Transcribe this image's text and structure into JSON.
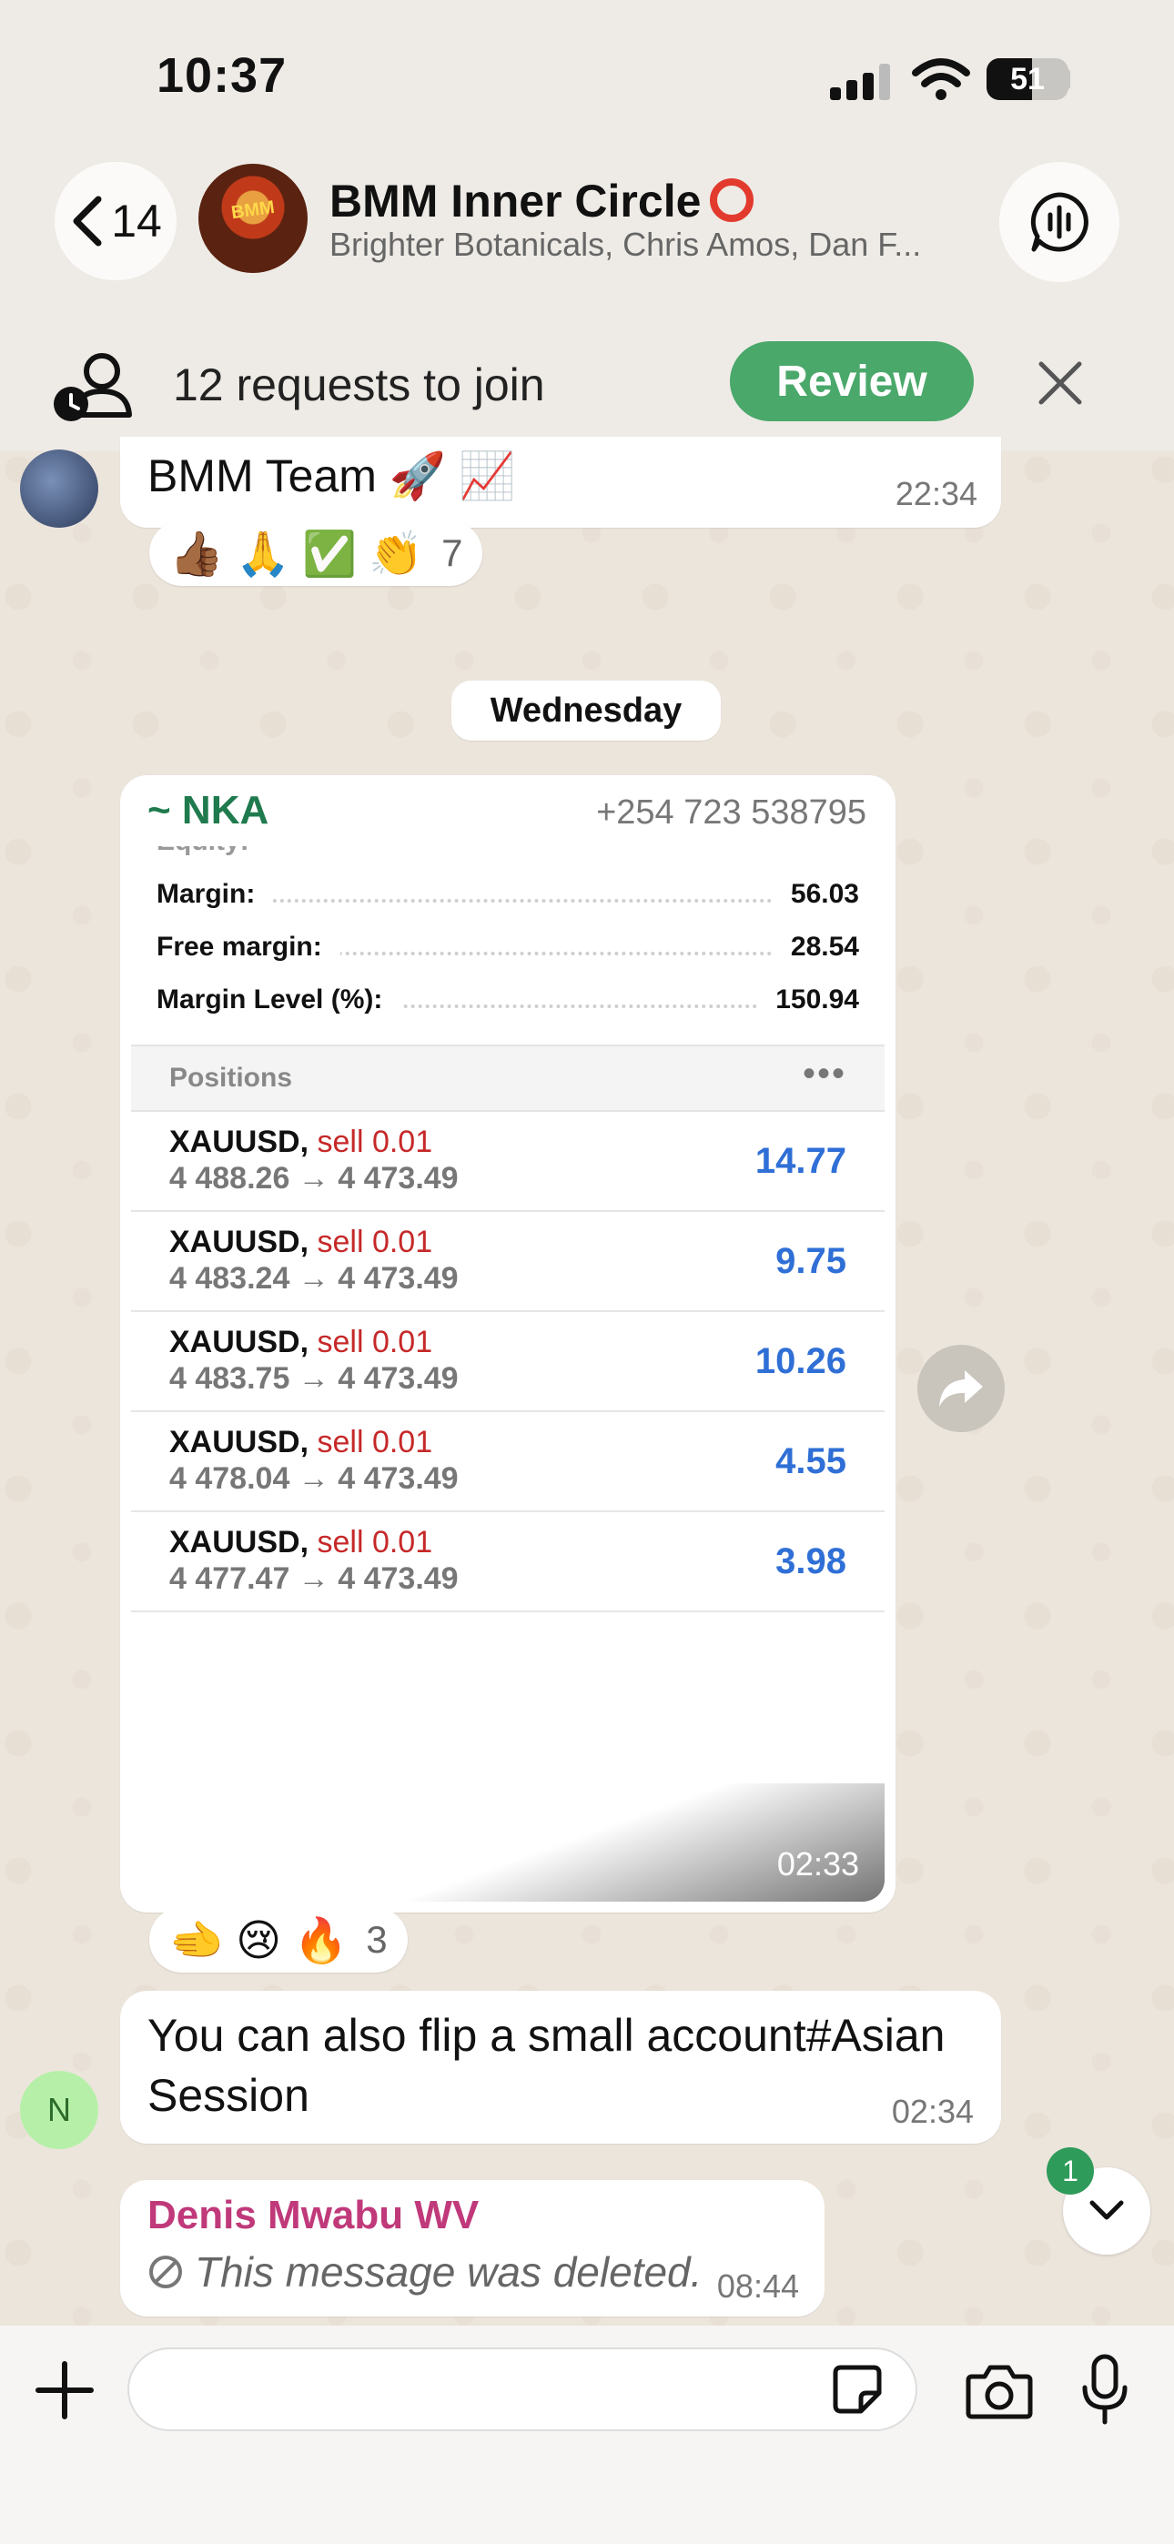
{
  "status": {
    "time": "10:37",
    "battery": "51"
  },
  "header": {
    "back_count": "14",
    "avatar_text": "BMM",
    "title": "BMM Inner Circle",
    "subtitle": "Brighter Botanicals, Chris Amos, Dan F..."
  },
  "join": {
    "text": "12 requests to join",
    "review_label": "Review"
  },
  "messages": {
    "m1": {
      "text": "BMM Team 🚀 📈",
      "time": "22:34",
      "reactions": "👍🏾 🙏 ✅ 👏",
      "reaction_count": "7"
    },
    "day": "Wednesday",
    "image_msg": {
      "sender": "~ NKA",
      "phone": "+254 723 538795",
      "time": "02:33",
      "reactions": "🫲 😢 🔥",
      "reaction_count": "3",
      "account": [
        {
          "label": "Margin:",
          "value": "56.03"
        },
        {
          "label": "Free margin:",
          "value": "28.54"
        },
        {
          "label": "Margin Level (%):",
          "value": "150.94"
        }
      ],
      "positions_title": "Positions",
      "positions": [
        {
          "symbol": "XAUUSD,",
          "side": "sell 0.01",
          "prices": "4 488.26 → 4 473.49",
          "pl": "14.77"
        },
        {
          "symbol": "XAUUSD,",
          "side": "sell 0.01",
          "prices": "4 483.24 → 4 473.49",
          "pl": "9.75"
        },
        {
          "symbol": "XAUUSD,",
          "side": "sell 0.01",
          "prices": "4 483.75 → 4 473.49",
          "pl": "10.26"
        },
        {
          "symbol": "XAUUSD,",
          "side": "sell 0.01",
          "prices": "4 478.04 → 4 473.49",
          "pl": "4.55"
        },
        {
          "symbol": "XAUUSD,",
          "side": "sell 0.01",
          "prices": "4 477.47 → 4 473.49",
          "pl": "3.98"
        }
      ]
    },
    "m3": {
      "avatar": "N",
      "text": "You can also flip a small account#Asian Session",
      "time": "02:34"
    },
    "m4": {
      "sender": "Denis Mwabu WV",
      "text": "This message was deleted.",
      "time": "08:44"
    }
  },
  "unread_badge": "1",
  "composer": {
    "value": ""
  },
  "colors": {
    "review": "#4aa86a",
    "sell": "#c62828",
    "profit": "#2f6fd6",
    "sender_nka": "#1f7a4d",
    "sender_denis": "#c0397a"
  }
}
